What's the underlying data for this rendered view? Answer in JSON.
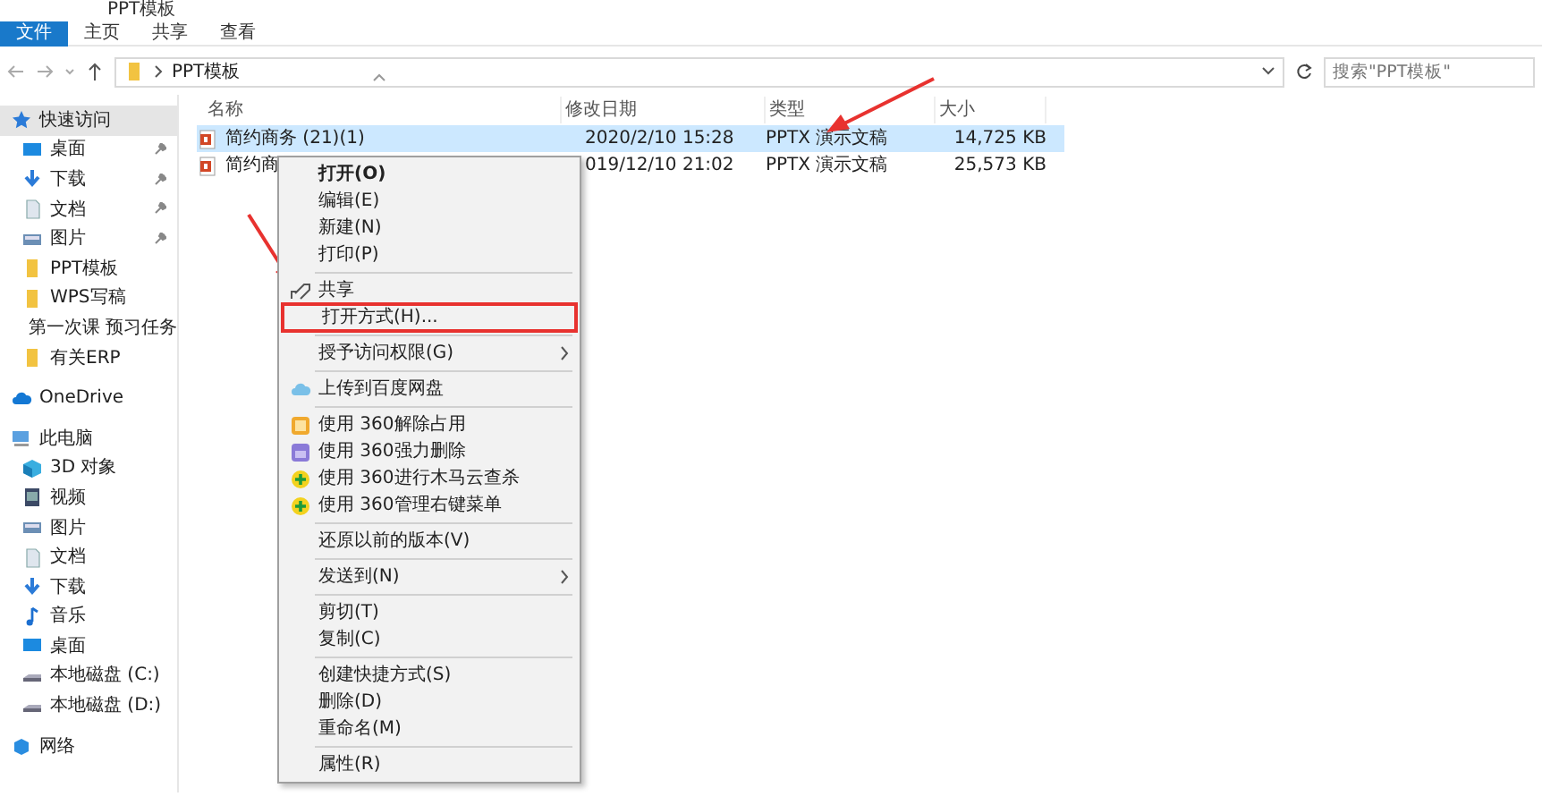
{
  "window": {
    "title": "PPT模板"
  },
  "ribbon_tabs": [
    {
      "label": "文件",
      "selected": true
    },
    {
      "label": "主页",
      "selected": false
    },
    {
      "label": "共享",
      "selected": false
    },
    {
      "label": "查看",
      "selected": false
    }
  ],
  "address_bar": {
    "path": [
      "PPT模板"
    ],
    "search_placeholder": "搜索\"PPT模板\""
  },
  "sidebar": {
    "items": [
      {
        "label": "快速访问",
        "kind": "star",
        "selected": true,
        "children": [
          {
            "label": "桌面",
            "kind": "desktop",
            "pinned": true
          },
          {
            "label": "下载",
            "kind": "download",
            "pinned": true
          },
          {
            "label": "文档",
            "kind": "docs",
            "pinned": true
          },
          {
            "label": "图片",
            "kind": "pictures",
            "pinned": true
          },
          {
            "label": "PPT模板",
            "kind": "folder",
            "pinned": false
          },
          {
            "label": "WPS写稿",
            "kind": "folder",
            "pinned": false
          },
          {
            "label": "第一次课 预习任务",
            "kind": "folder",
            "pinned": false
          },
          {
            "label": "有关ERP",
            "kind": "folder",
            "pinned": false
          }
        ]
      },
      {
        "label": "OneDrive",
        "kind": "cloud",
        "selected": false
      },
      {
        "label": "此电脑",
        "kind": "pc",
        "selected": false,
        "children": [
          {
            "label": "3D 对象",
            "kind": "cube"
          },
          {
            "label": "视频",
            "kind": "video"
          },
          {
            "label": "图片",
            "kind": "pictures"
          },
          {
            "label": "文档",
            "kind": "docs"
          },
          {
            "label": "下载",
            "kind": "download"
          },
          {
            "label": "音乐",
            "kind": "music"
          },
          {
            "label": "桌面",
            "kind": "desktop"
          },
          {
            "label": "本地磁盘 (C:)",
            "kind": "drive"
          },
          {
            "label": "本地磁盘 (D:)",
            "kind": "drive"
          }
        ]
      },
      {
        "label": "网络",
        "kind": "network",
        "selected": false
      }
    ]
  },
  "file_list": {
    "columns": [
      "名称",
      "修改日期",
      "类型",
      "大小"
    ],
    "rows": [
      {
        "name": "简约商务 (21)(1)",
        "modified": "2020/2/10 15:28",
        "type": "PPTX 演示文稿",
        "size": "14,725 KB",
        "selected": true
      },
      {
        "name": "简约商",
        "modified": "019/12/10 21:02",
        "type": "PPTX 演示文稿",
        "size": "25,573 KB",
        "selected": false
      }
    ]
  },
  "context_menu": {
    "items": [
      {
        "kind": "plain",
        "label": "打开(O)",
        "default": true
      },
      {
        "kind": "plain",
        "label": "编辑(E)"
      },
      {
        "kind": "plain",
        "label": "新建(N)"
      },
      {
        "kind": "plain",
        "label": "打印(P)"
      },
      {
        "kind": "separator"
      },
      {
        "kind": "share",
        "label": "共享"
      },
      {
        "kind": "plain",
        "label": "打开方式(H)...",
        "highlighted": true
      },
      {
        "kind": "separator"
      },
      {
        "kind": "plain",
        "label": "授予访问权限(G)",
        "submenu": true
      },
      {
        "kind": "separator"
      },
      {
        "kind": "upload",
        "label": "上传到百度网盘"
      },
      {
        "kind": "separator"
      },
      {
        "kind": "unlock",
        "label": "使用 360解除占用"
      },
      {
        "kind": "delete",
        "label": "使用 360强力删除"
      },
      {
        "kind": "scan",
        "label": "使用 360进行木马云查杀"
      },
      {
        "kind": "scan",
        "label": "使用 360管理右键菜单"
      },
      {
        "kind": "separator"
      },
      {
        "kind": "plain",
        "label": "还原以前的版本(V)"
      },
      {
        "kind": "separator"
      },
      {
        "kind": "plain",
        "label": "发送到(N)",
        "submenu": true
      },
      {
        "kind": "separator"
      },
      {
        "kind": "plain",
        "label": "剪切(T)"
      },
      {
        "kind": "plain",
        "label": "复制(C)"
      },
      {
        "kind": "separator"
      },
      {
        "kind": "plain",
        "label": "创建快捷方式(S)"
      },
      {
        "kind": "plain",
        "label": "删除(D)"
      },
      {
        "kind": "plain",
        "label": "重命名(M)"
      },
      {
        "kind": "separator"
      },
      {
        "kind": "plain",
        "label": "属性(R)"
      }
    ]
  }
}
